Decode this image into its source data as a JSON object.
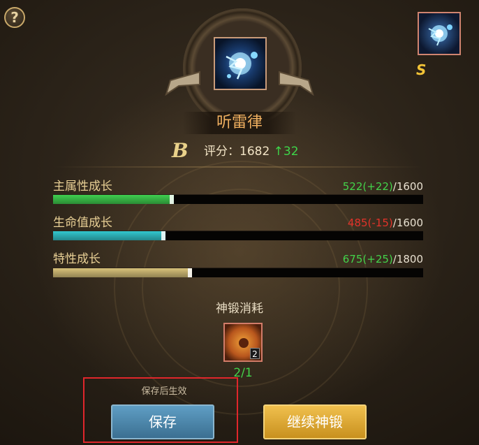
{
  "help_button": {
    "label": "?"
  },
  "corner": {
    "icon": "lightning-orb-icon",
    "grade": "S"
  },
  "item": {
    "icon": "lightning-orb-icon",
    "name": "听雷律"
  },
  "score": {
    "grade": "B",
    "label": "评分：",
    "value": "1682",
    "delta_arrow": "↑",
    "delta": "32"
  },
  "stats": [
    {
      "label": "主属性成长",
      "current": "522",
      "change": "(+22)",
      "change_color": "green",
      "max": "/1600",
      "fill": 0.326,
      "bar_color": "#3fcf4f"
    },
    {
      "label": "生命值成长",
      "current": "485",
      "change": "(-15)",
      "change_color": "red",
      "max": "/1600",
      "fill": 0.303,
      "bar_color": "#32c8cf"
    },
    {
      "label": "特性成长",
      "current": "675",
      "change": "(+25)",
      "change_color": "green",
      "max": "/1800",
      "fill": 0.375,
      "bar_color": "#d8c27a"
    }
  ],
  "cost": {
    "title": "神锻消耗",
    "icon": "gold-coin-icon",
    "count": "2",
    "progress": "2/1"
  },
  "actions": {
    "hint": "保存后生效",
    "save": "保存",
    "continue": "继续神锻"
  },
  "colors": {
    "accent_gold": "#f0b060",
    "positive": "#43d24a",
    "negative": "#e2332a",
    "highlight": "#e0262b"
  }
}
